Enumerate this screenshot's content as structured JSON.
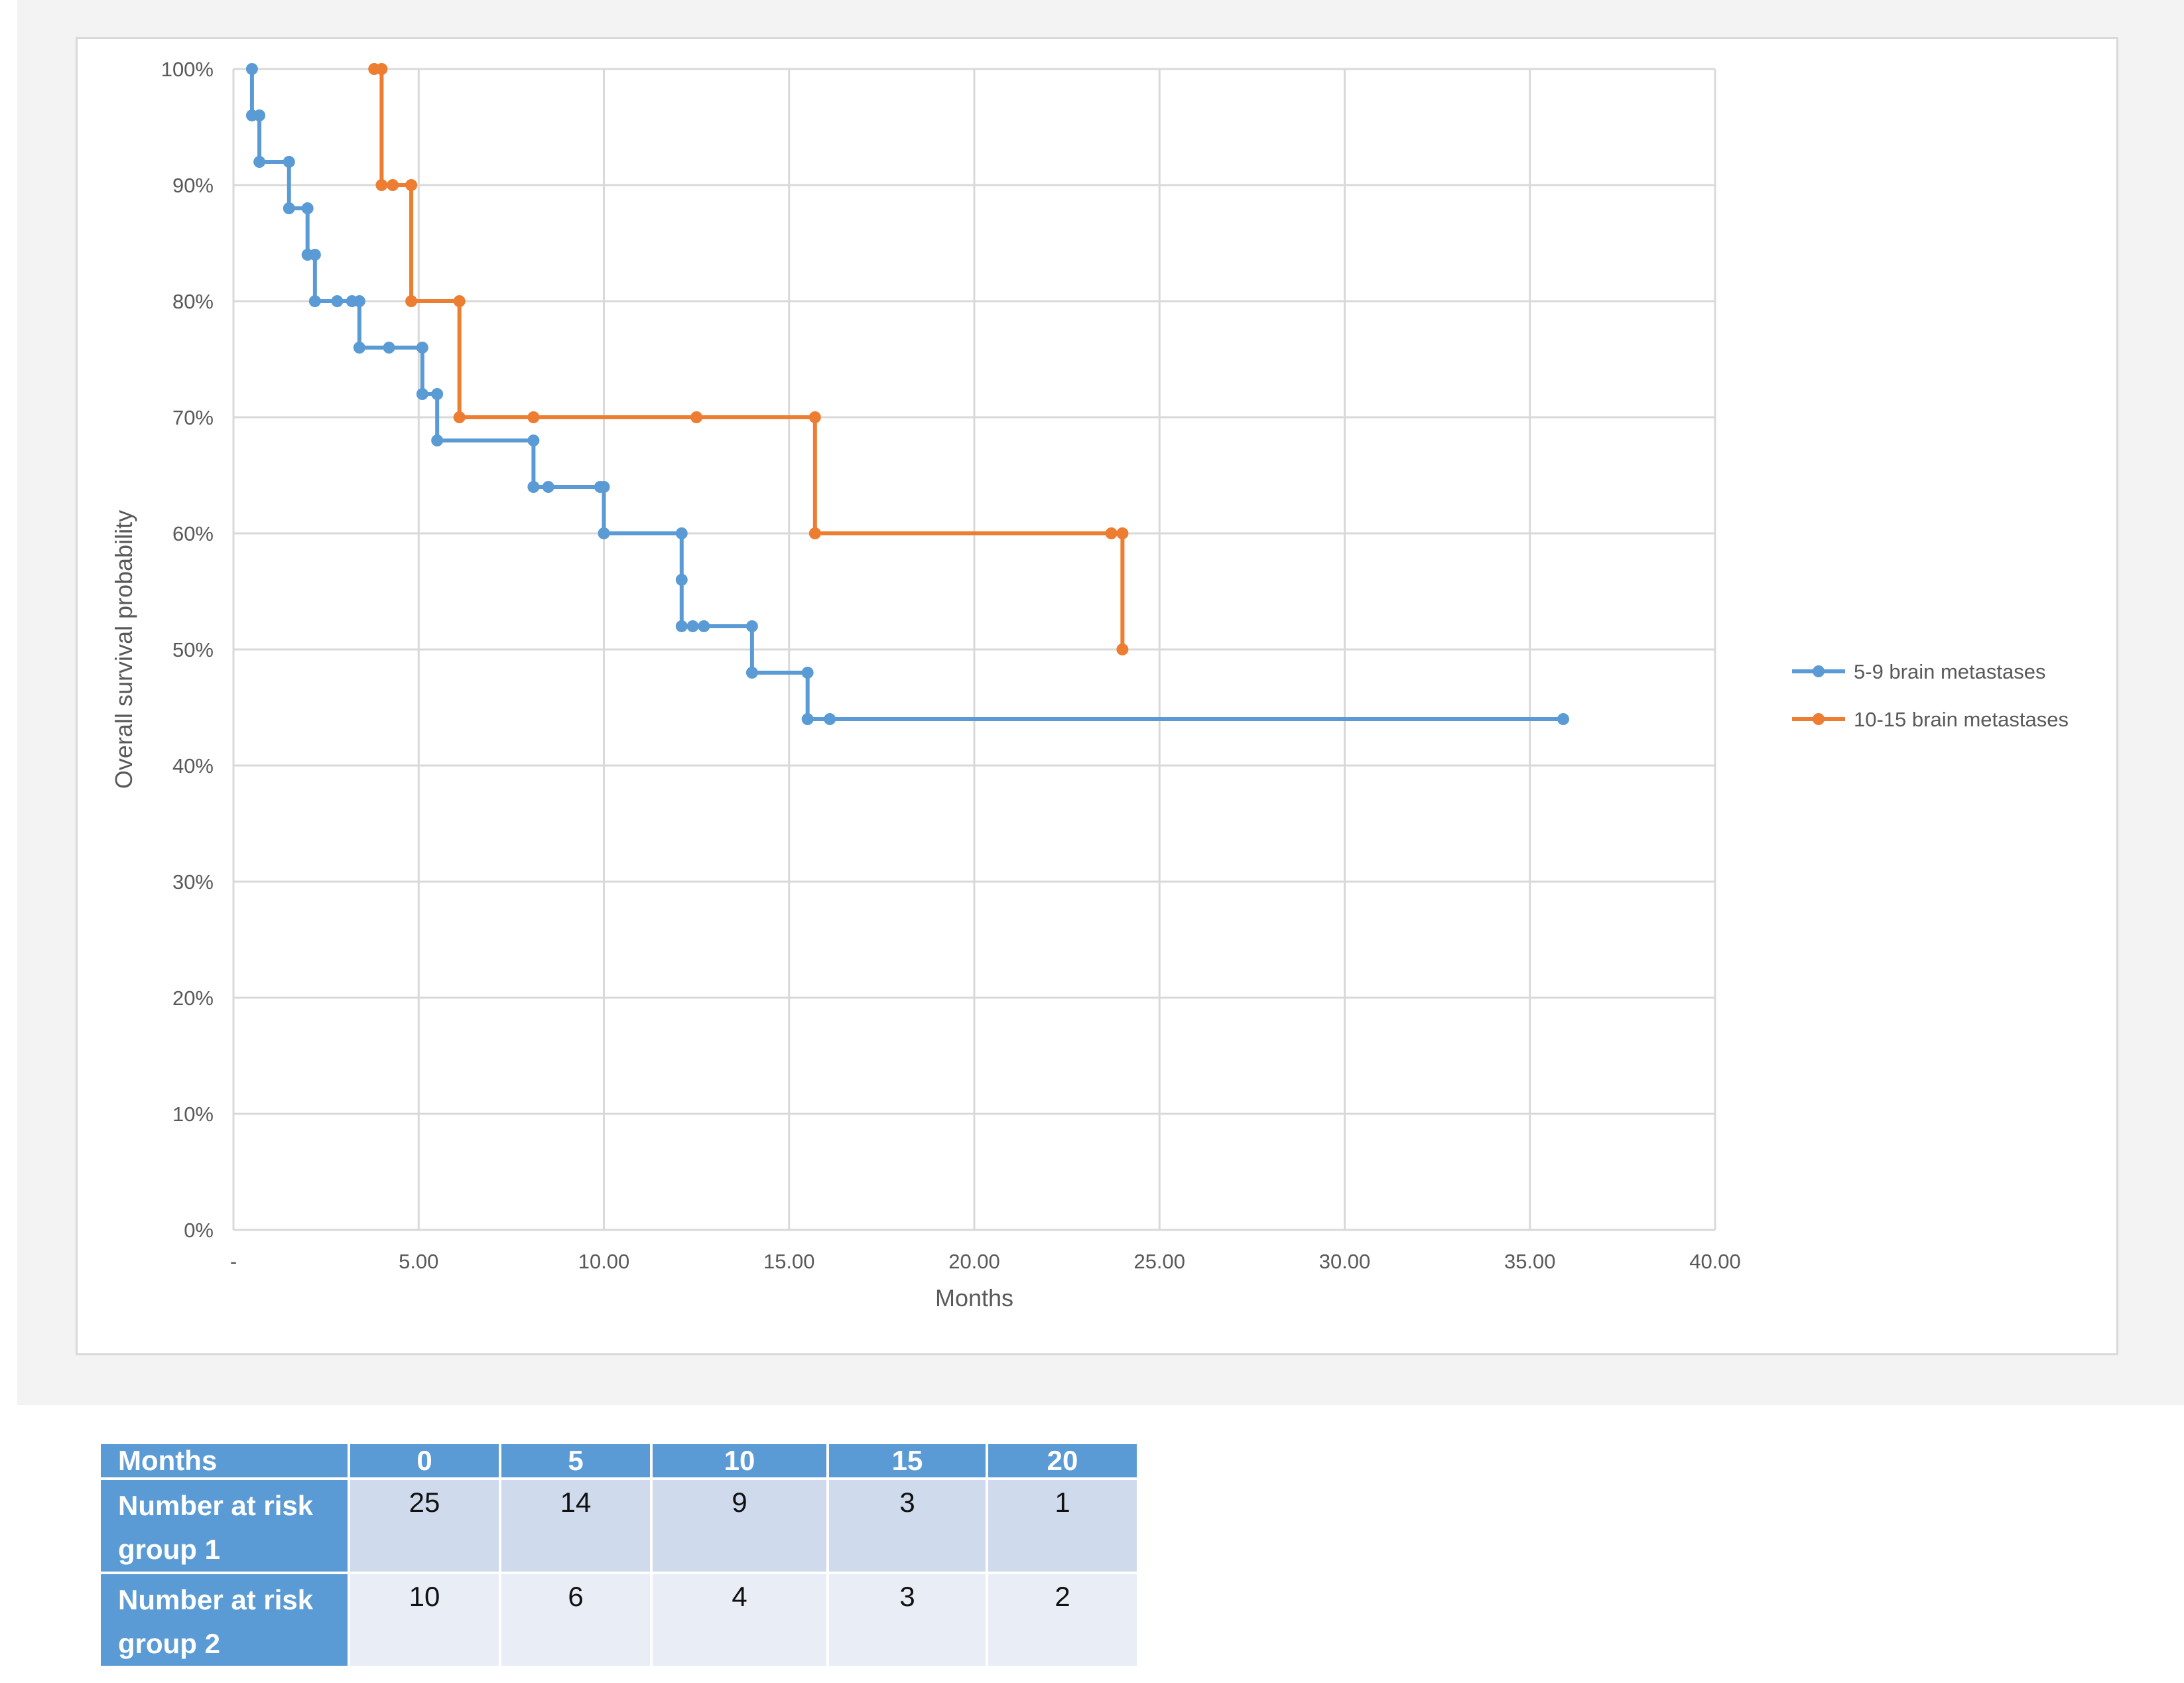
{
  "chart_data": {
    "type": "line",
    "step": true,
    "title": "",
    "xlabel": "Months",
    "ylabel": "Overall survival probability",
    "xlim": [
      0,
      40
    ],
    "ylim": [
      0,
      1
    ],
    "x_ticks": [
      "-",
      "5.00",
      "10.00",
      "15.00",
      "20.00",
      "25.00",
      "30.00",
      "35.00",
      "40.00"
    ],
    "y_ticks": [
      "0%",
      "10%",
      "20%",
      "30%",
      "40%",
      "50%",
      "60%",
      "70%",
      "80%",
      "90%",
      "100%"
    ],
    "grid": true,
    "legend_position": "right",
    "series": [
      {
        "name": "5-9 brain metastases",
        "color": "#5b9bd5",
        "points": [
          [
            0.5,
            1.0
          ],
          [
            0.5,
            0.96
          ],
          [
            0.7,
            0.96
          ],
          [
            0.7,
            0.92
          ],
          [
            1.5,
            0.92
          ],
          [
            1.5,
            0.88
          ],
          [
            2.0,
            0.88
          ],
          [
            2.0,
            0.84
          ],
          [
            2.2,
            0.84
          ],
          [
            2.2,
            0.8
          ],
          [
            2.8,
            0.8
          ],
          [
            3.2,
            0.8
          ],
          [
            3.4,
            0.8
          ],
          [
            3.4,
            0.76
          ],
          [
            4.2,
            0.76
          ],
          [
            5.1,
            0.76
          ],
          [
            5.1,
            0.72
          ],
          [
            5.5,
            0.72
          ],
          [
            5.5,
            0.68
          ],
          [
            8.1,
            0.68
          ],
          [
            8.1,
            0.64
          ],
          [
            8.5,
            0.64
          ],
          [
            9.9,
            0.64
          ],
          [
            10.0,
            0.64
          ],
          [
            10.0,
            0.6
          ],
          [
            12.1,
            0.6
          ],
          [
            12.1,
            0.56
          ],
          [
            12.1,
            0.52
          ],
          [
            12.4,
            0.52
          ],
          [
            12.7,
            0.52
          ],
          [
            14.0,
            0.52
          ],
          [
            14.0,
            0.48
          ],
          [
            15.5,
            0.48
          ],
          [
            15.5,
            0.44
          ],
          [
            16.1,
            0.44
          ],
          [
            35.9,
            0.44
          ]
        ]
      },
      {
        "name": "10-15 brain metastases",
        "color": "#ed7d31",
        "points": [
          [
            3.8,
            1.0
          ],
          [
            4.0,
            1.0
          ],
          [
            4.0,
            0.9
          ],
          [
            4.3,
            0.9
          ],
          [
            4.8,
            0.9
          ],
          [
            4.8,
            0.8
          ],
          [
            6.1,
            0.8
          ],
          [
            6.1,
            0.7
          ],
          [
            8.1,
            0.7
          ],
          [
            12.5,
            0.7
          ],
          [
            15.7,
            0.7
          ],
          [
            15.7,
            0.6
          ],
          [
            23.7,
            0.6
          ],
          [
            24.0,
            0.6
          ],
          [
            24.0,
            0.5
          ]
        ]
      }
    ]
  },
  "risk_table": {
    "header_label": "Months",
    "months": [
      "0",
      "5",
      "10",
      "15",
      "20"
    ],
    "rows": [
      {
        "label_line1": "Number at risk",
        "label_line2": "group 1",
        "values": [
          "25",
          "14",
          "9",
          "3",
          "1"
        ]
      },
      {
        "label_line1": "Number at risk",
        "label_line2": "group 2",
        "values": [
          "10",
          "6",
          "4",
          "3",
          "2"
        ]
      }
    ]
  }
}
